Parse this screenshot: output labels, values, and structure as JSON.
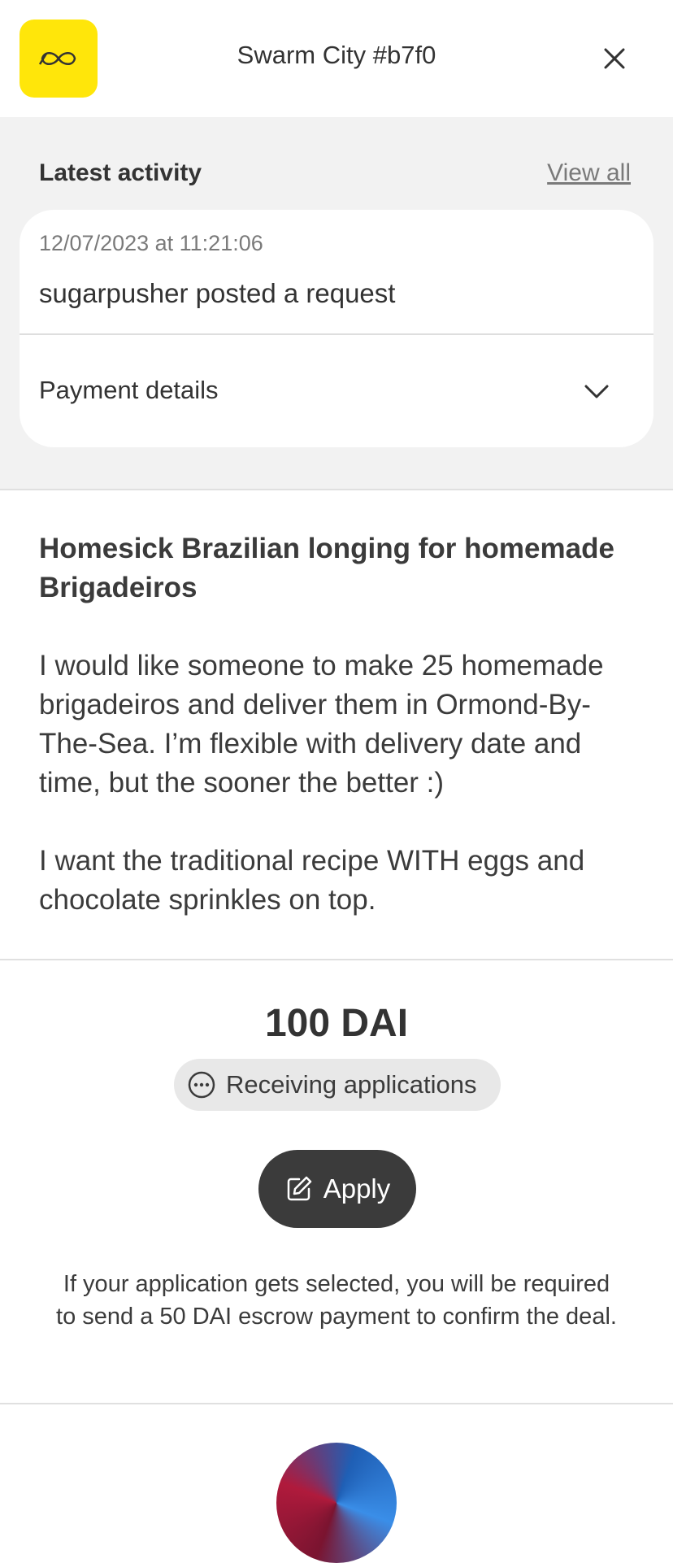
{
  "header": {
    "title": "Swarm City #b7f0",
    "brand_color": "#ffe60a"
  },
  "activity": {
    "heading": "Latest activity",
    "view_all": "View all",
    "timestamp": "12/07/2023 at 11:21:06",
    "event": "sugarpusher posted a request",
    "payment_details": "Payment details"
  },
  "request": {
    "title": "Homesick Brazilian longing for homemade Brigadeiros",
    "paragraphs": [
      "I would like someone to make 25 homemade brigadeiros and deliver them in Ormond-By-The-Sea. I’m flexible with delivery date and time, but the sooner the better :)",
      "I want the traditional recipe WITH eggs and chocolate sprinkles on top."
    ]
  },
  "reward": {
    "amount": "100 DAI",
    "status": "Receiving applications",
    "apply_label": "Apply",
    "note": "If your application gets selected, you will be required to send a 50 DAI escrow payment to confirm the deal."
  },
  "icons": {
    "logo": "infinity-logo-icon",
    "close": "close-icon",
    "chevron": "chevron-down-icon",
    "status": "more-dots-icon",
    "apply": "edit-icon"
  }
}
